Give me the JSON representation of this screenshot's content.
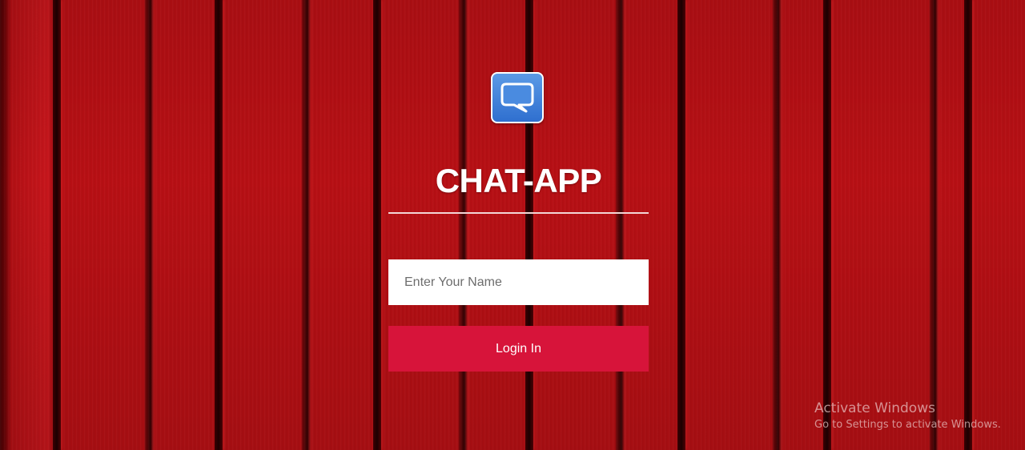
{
  "app": {
    "title": "CHAT-APP",
    "logo_icon": "chat-bubble-icon",
    "logo_color": "#3a7bd5"
  },
  "login": {
    "name_placeholder": "Enter Your Name",
    "name_value": "",
    "button_label": "Login In",
    "button_color": "#d7143a"
  },
  "watermark": {
    "title": "Activate Windows",
    "subtitle": "Go to Settings to activate Windows."
  },
  "theme": {
    "background": "red wooden planks",
    "primary_red": "#b80f14"
  }
}
